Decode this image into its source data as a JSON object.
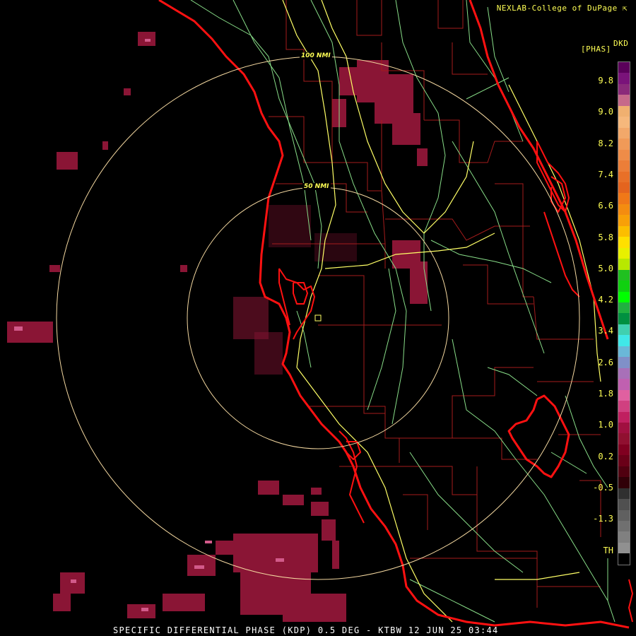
{
  "header": {
    "credit": "NEXLAB-College of DuPage",
    "credit_icon": "cursor-arrow-icon",
    "product_code": "DKD",
    "product_units": "[PHAS]"
  },
  "footer": {
    "product_line": "SPECIFIC DIFFERENTIAL PHASE (KDP) 0.5 DEG - KTBW 12 JUN 25 03:44"
  },
  "range_rings": [
    {
      "label": "100 NMI",
      "range_nmi": 100
    },
    {
      "label": "50 NMI",
      "range_nmi": 50
    }
  ],
  "color_scale": {
    "tick_labels": [
      "9.8",
      "9.0",
      "8.2",
      "7.4",
      "6.6",
      "5.8",
      "5.0",
      "4.2",
      "3.4",
      "2.6",
      "1.8",
      "1.0",
      "0.2",
      "-0.5",
      "-1.3",
      "TH"
    ],
    "colors": [
      "#5a005a",
      "#7a137a",
      "#8a2a7a",
      "#c66a8a",
      "#f0b070",
      "#f6b87c",
      "#f2a86a",
      "#f09a58",
      "#ee8c48",
      "#ec7e38",
      "#e87028",
      "#e4641e",
      "#f07818",
      "#f48c10",
      "#f8a008",
      "#fcbe00",
      "#ffe000",
      "#e8f000",
      "#b8e800",
      "#20c020",
      "#10d010",
      "#00ff00",
      "#20b040",
      "#009040",
      "#40d0b0",
      "#40e8e8",
      "#6ab8d8",
      "#8090c8",
      "#a870b8",
      "#c060b0",
      "#e060a0",
      "#d04080",
      "#c02060",
      "#a01040",
      "#901030",
      "#800020",
      "#6a0018",
      "#500010",
      "#300008",
      "#303030",
      "#505050",
      "#606060",
      "#707070",
      "#808080",
      "#909090",
      "#000000"
    ]
  },
  "map_colors": {
    "coastline": "#ff1111",
    "county_lines": "#a51c1c",
    "highways_major": "#ffff66",
    "highways_minor": "#88dd88",
    "range_rings": "#f4d8a0",
    "echo_weak": "#6a0f25",
    "echo_moderate": "#8a1535",
    "echo_strong": "#d25a8a"
  }
}
